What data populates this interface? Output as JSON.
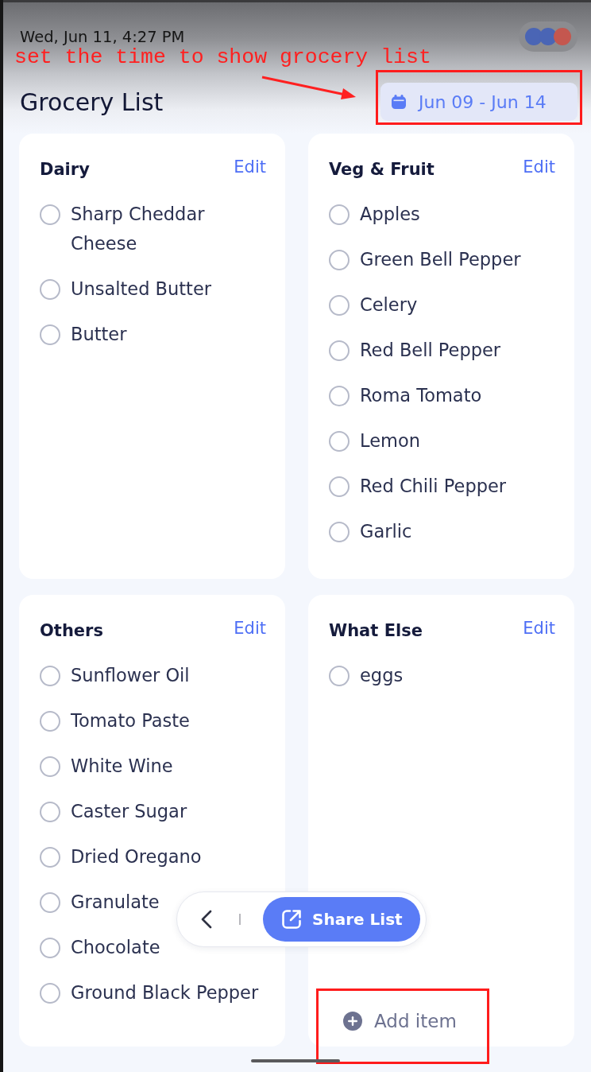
{
  "status_bar": {
    "time": "Wed, Jun 11, 4:27 PM",
    "avatars": [
      {
        "color": "#4a65b5"
      },
      {
        "color": "#4a65b5"
      },
      {
        "color": "#c4574f"
      }
    ]
  },
  "annotation": {
    "note": "set the time to show grocery list"
  },
  "header": {
    "title": "Grocery List",
    "date_range": {
      "label": "Jun 09 - Jun 14",
      "highlighted": true
    }
  },
  "categories": [
    {
      "name": "Dairy",
      "edit_label": "Edit",
      "items": [
        {
          "label": "Sharp Cheddar Cheese",
          "checked": false
        },
        {
          "label": "Unsalted Butter",
          "checked": false
        },
        {
          "label": "Butter",
          "checked": false
        }
      ]
    },
    {
      "name": "Veg & Fruit",
      "edit_label": "Edit",
      "items": [
        {
          "label": "Apples",
          "checked": false
        },
        {
          "label": "Green Bell Pepper",
          "checked": false
        },
        {
          "label": "Celery",
          "checked": false
        },
        {
          "label": "Red Bell Pepper",
          "checked": false
        },
        {
          "label": "Roma Tomato",
          "checked": false
        },
        {
          "label": "Lemon",
          "checked": false
        },
        {
          "label": "Red Chili Pepper",
          "checked": false
        },
        {
          "label": "Garlic",
          "checked": false
        }
      ]
    },
    {
      "name": "Others",
      "edit_label": "Edit",
      "items": [
        {
          "label": "Sunflower Oil",
          "checked": false
        },
        {
          "label": "Tomato Paste",
          "checked": false
        },
        {
          "label": "White Wine",
          "checked": false
        },
        {
          "label": "Caster Sugar",
          "checked": false
        },
        {
          "label": "Dried Oregano",
          "checked": false
        },
        {
          "label": "Granulate",
          "checked": false
        },
        {
          "label": "Chocolate",
          "checked": false
        },
        {
          "label": "Ground Black Pepper",
          "checked": false
        }
      ]
    },
    {
      "name": "What Else",
      "edit_label": "Edit",
      "items": [
        {
          "label": "eggs",
          "checked": false
        }
      ],
      "add_item": {
        "label": "Add item",
        "highlighted": true
      }
    }
  ],
  "toolbar": {
    "share_label": "Share List"
  }
}
